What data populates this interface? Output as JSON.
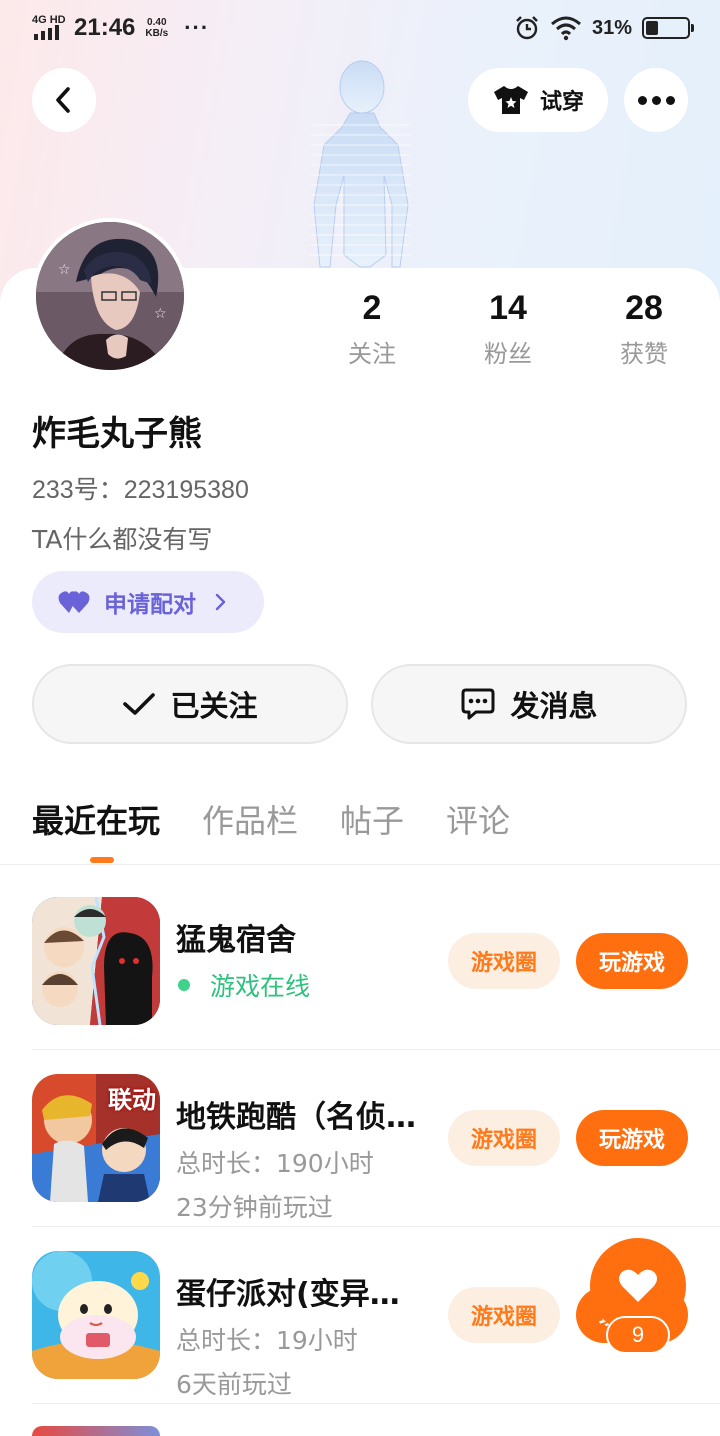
{
  "status_bar": {
    "network": "4G HD",
    "time": "21:46",
    "speed_value": "0.40",
    "speed_unit": "KB/s",
    "battery_pct": "31%",
    "battery_level": 0.31
  },
  "nav": {
    "try_on_label": "试穿"
  },
  "profile": {
    "stats": [
      {
        "num": "2",
        "label": "关注"
      },
      {
        "num": "14",
        "label": "粉丝"
      },
      {
        "num": "28",
        "label": "获赞"
      }
    ],
    "name": "炸毛丸子熊",
    "uid": "233号：223195380",
    "bio": "TA什么都没有写",
    "pair_label": "申请配对"
  },
  "actions": {
    "follow_label": "已关注",
    "message_label": "发消息"
  },
  "tabs": [
    {
      "label": "最近在玩"
    },
    {
      "label": "作品栏"
    },
    {
      "label": "帖子"
    },
    {
      "label": "评论"
    }
  ],
  "games": [
    {
      "title": "猛鬼宿舍",
      "status": "游戏在线",
      "circle_label": "游戏圈",
      "play_label": "玩游戏"
    },
    {
      "title": "地铁跑酷（名侦…",
      "duration": "总时长：190小时",
      "last_played": "23分钟前玩过",
      "circle_label": "游戏圈",
      "play_label": "玩游戏"
    },
    {
      "title": "蛋仔派对(变异…",
      "duration": "总时长：19小时",
      "last_played": "6天前玩过",
      "circle_label": "游戏圈",
      "play_label": "玩游戏"
    }
  ],
  "game_icon_text": {
    "subway": "联动"
  },
  "like_fab": {
    "count": "9"
  },
  "colors": {
    "accent": "#ff6f0f",
    "pair_purple": "#6a62d8",
    "online_green": "#2ec27e"
  }
}
